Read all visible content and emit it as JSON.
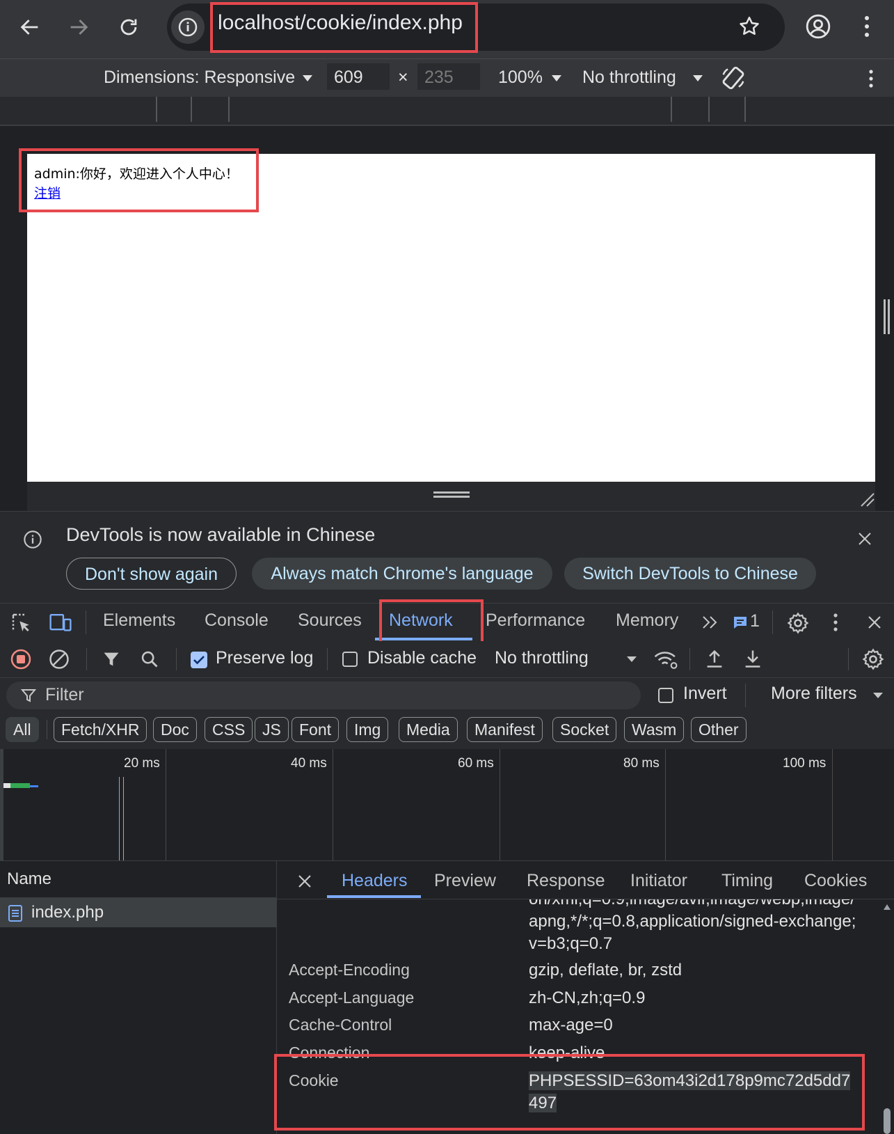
{
  "browser": {
    "url": "localhost/cookie/index.php"
  },
  "device_toolbar": {
    "dimensions_label": "Dimensions: Responsive",
    "width": "609",
    "times": "×",
    "height": "235",
    "zoom": "100%",
    "throttling": "No throttling"
  },
  "page": {
    "greeting": "admin:你好，欢迎进入个人中心！",
    "logout_link": "注销"
  },
  "infobar": {
    "message": "DevTools is now available in Chinese",
    "buttons": [
      "Don't show again",
      "Always match Chrome's language",
      "Switch DevTools to Chinese"
    ]
  },
  "devtools_tabs": {
    "items": [
      "Elements",
      "Console",
      "Sources",
      "Network",
      "Performance",
      "Memory"
    ],
    "active": "Network",
    "issues_count": "1"
  },
  "network_toolbar": {
    "preserve_log": "Preserve log",
    "preserve_log_checked": true,
    "disable_cache": "Disable cache",
    "disable_cache_checked": false,
    "throttling": "No throttling"
  },
  "filter": {
    "placeholder": "Filter",
    "invert": "Invert",
    "more_filters": "More filters"
  },
  "type_filters": [
    "All",
    "Fetch/XHR",
    "Doc",
    "CSS",
    "JS",
    "Font",
    "Img",
    "Media",
    "Manifest",
    "Socket",
    "Wasm",
    "Other"
  ],
  "timeline": {
    "labels": [
      "20 ms",
      "40 ms",
      "60 ms",
      "80 ms",
      "100 ms"
    ]
  },
  "requests": {
    "column": "Name",
    "items": [
      "index.php"
    ]
  },
  "details": {
    "tabs": [
      "Headers",
      "Preview",
      "Response",
      "Initiator",
      "Timing",
      "Cookies"
    ],
    "active_tab": "Headers",
    "headers": [
      {
        "name": "",
        "value": "on/xml;q=0.9,image/avif,image/webp,image/apng,*/*;q=0.8,application/signed-exchange;v=b3;q=0.7"
      },
      {
        "name": "Accept-Encoding",
        "value": "gzip, deflate, br, zstd"
      },
      {
        "name": "Accept-Language",
        "value": "zh-CN,zh;q=0.9"
      },
      {
        "name": "Cache-Control",
        "value": "max-age=0"
      },
      {
        "name": "Connection",
        "value": "keep-alive"
      },
      {
        "name": "Cookie",
        "value": "PHPSESSID=63om43i2d178p9mc72d5dd7497"
      }
    ]
  },
  "colors": {
    "highlight_red": "#e5484d",
    "accent_blue": "#7cacf8",
    "record_red": "#f28b82"
  }
}
